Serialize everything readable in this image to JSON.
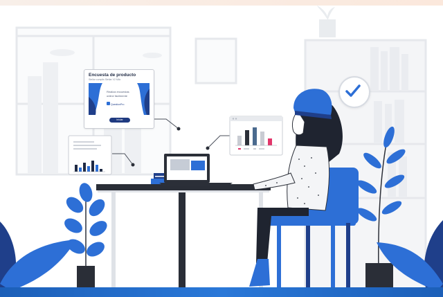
{
  "survey_card": {
    "title": "Encuesta de producto",
    "subtitle": "Stellar cumplis Stellar V2 Milo",
    "line1": "Realiza encuestas",
    "line2": "online fácilmente",
    "brand": "QuestionPro",
    "button_label": "Iniciar"
  },
  "colors": {
    "accent_blue": "#2d6fd6",
    "dark_navy": "#1f2a44",
    "pink_highlight": "#e2366b",
    "bottom_band": "#1c5fb8"
  },
  "icons": [
    "check-icon",
    "leaf-plant-icon",
    "laptop-icon",
    "bar-chart-icon",
    "document-icon"
  ]
}
